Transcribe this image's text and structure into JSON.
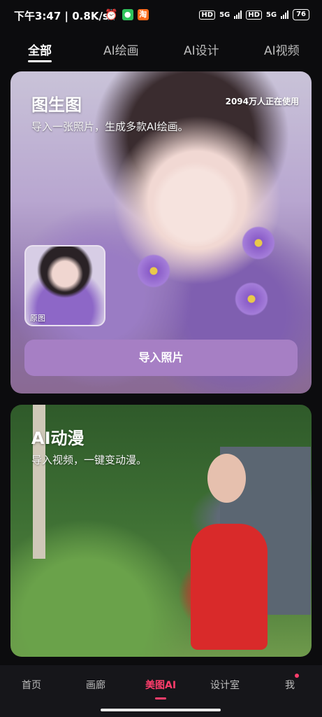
{
  "status_bar": {
    "time": "下午3:47",
    "network_speed": "0.8K/s",
    "alarm_icon": "alarm-icon",
    "wechat_icon": "wechat-icon",
    "app_icon": "taobao-icon",
    "hd1": "HD",
    "net1": "5G",
    "hd2": "HD",
    "net2": "5G",
    "battery": "76"
  },
  "tabs": [
    {
      "label": "全部",
      "active": true
    },
    {
      "label": "AI绘画",
      "active": false
    },
    {
      "label": "AI设计",
      "active": false
    },
    {
      "label": "AI视频",
      "active": false
    }
  ],
  "card1": {
    "title": "图生图",
    "subtitle": "导入一张照片，生成多款AI绘画。",
    "usage": "2094万人正在使用",
    "thumb_label": "原图",
    "button": "导入照片"
  },
  "card2": {
    "title": "AI动漫",
    "subtitle": "导入视频，一键变动漫。"
  },
  "bottom_nav": [
    {
      "label": "首页",
      "active": false
    },
    {
      "label": "画廊",
      "active": false
    },
    {
      "label": "美图AI",
      "active": true
    },
    {
      "label": "设计室",
      "active": false
    },
    {
      "label": "我",
      "active": false
    }
  ],
  "colors": {
    "accent": "#ff3d6b",
    "button": "#a67fc4",
    "background": "#0c0c0e"
  }
}
